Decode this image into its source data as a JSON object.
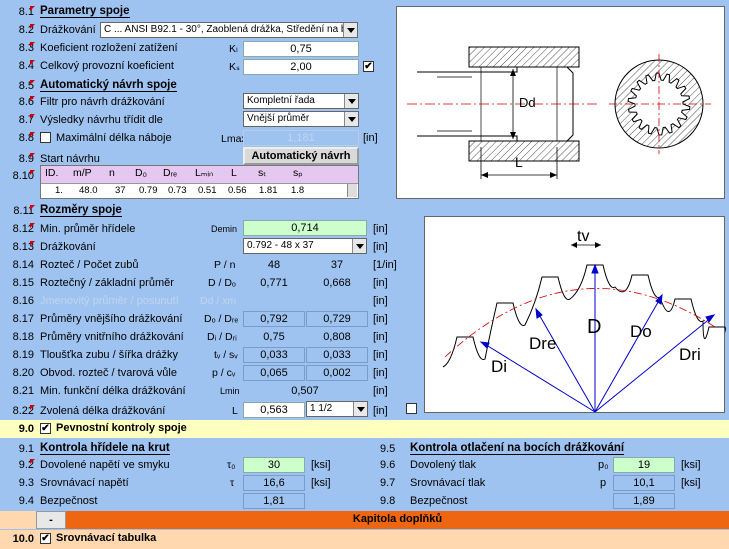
{
  "colors": {
    "background": "#9fc3f0",
    "input_green": "#ccffcc",
    "section_yellow": "#ffffc0",
    "chapter_orange": "#ee6611",
    "chapter_bg": "#ffd8b0",
    "marker_red": "#d00000"
  },
  "s81": {
    "num": "8.1",
    "title": "Parametry spoje"
  },
  "s82": {
    "num": "8.2",
    "label": "Drážkování",
    "value": "C ... ANSI B92.1 - 30°, Zaoblená drážka, Středění na bok"
  },
  "s83": {
    "num": "8.3",
    "label": "Koeficient rozložení zatížení",
    "sym": "Kₗ",
    "value": "0,75"
  },
  "s84": {
    "num": "8.4",
    "label": "Celkový provozní koeficient",
    "sym": "Kₛ",
    "value": "2,00",
    "checked": "✔"
  },
  "s85": {
    "num": "8.5",
    "title": "Automatický návrh spoje"
  },
  "s86": {
    "num": "8.6",
    "label": "Filtr pro návrh drážkování",
    "value": "Kompletní řada"
  },
  "s87": {
    "num": "8.7",
    "label": "Výsledky návrhu třídit dle",
    "value": "Vnější průměr"
  },
  "s88": {
    "num": "8.8",
    "label": "Maximální délka náboje",
    "sym": "Lmax",
    "value": "1,181",
    "unit": "[in]"
  },
  "s89": {
    "num": "8.9",
    "label": "Start návrhu",
    "button": "Automatický návrh"
  },
  "s810": {
    "num": "8.10",
    "headers": [
      "ID.",
      "m/P",
      "n",
      "D₀",
      "Dᵣₑ",
      "Lₘᵢₙ",
      "L",
      "sₜ",
      "sₚ"
    ],
    "row": [
      "1.",
      "48.0",
      "37",
      "0.79",
      "0.73",
      "0.51",
      "0.56",
      "1.81",
      "1.8"
    ]
  },
  "s811": {
    "num": "8.11",
    "title": "Rozměry spoje"
  },
  "s812": {
    "num": "8.12",
    "label": "Min. průměr hřídele",
    "sym": "Demin",
    "value": "0,714",
    "unit": "[in]"
  },
  "s813": {
    "num": "8.13",
    "label": "Drážkování",
    "value": "0.792 - 48 x 37",
    "unit": "[in]"
  },
  "s814": {
    "num": "8.14",
    "label": "Rozteč / Počet zubů",
    "sym": "P / n",
    "v1": "48",
    "v2": "37",
    "unit": "[1/in]"
  },
  "s815": {
    "num": "8.15",
    "label": "Roztečný / základní průměr",
    "sym": "D / Dₒ",
    "v1": "0,771",
    "v2": "0,668",
    "unit": "[in]"
  },
  "s816": {
    "num": "8.16",
    "label": "Jmenovitý průměr / posunutí",
    "sym": "Dd / xm",
    "unit": "[in]"
  },
  "s817": {
    "num": "8.17",
    "label": "Průměry vnějšího drážkování",
    "sym": "Dₒ / Dᵣₑ",
    "v1": "0,792",
    "v2": "0,729",
    "unit": "[in]"
  },
  "s818": {
    "num": "8.18",
    "label": "Průměry vnitřního drážkování",
    "sym": "Dᵢ / Dᵣᵢ",
    "v1": "0,75",
    "v2": "0,808",
    "unit": "[in]"
  },
  "s819": {
    "num": "8.19",
    "label": "Tloušťka zubu / šířka drážky",
    "sym": "tᵥ / sᵥ",
    "v1": "0,033",
    "v2": "0,033",
    "unit": "[in]"
  },
  "s820": {
    "num": "8.20",
    "label": "Obvod. rozteč / tvarová vůle",
    "sym": "p / cᵥ",
    "v1": "0,065",
    "v2": "0,002",
    "unit": "[in]"
  },
  "s821": {
    "num": "8.21",
    "label": "Min. funkční délka drážkování",
    "sym": "Lmin",
    "value": "0,507",
    "unit": "[in]"
  },
  "s822": {
    "num": "8.22",
    "label": "Zvolená délka drážkování",
    "sym": "L",
    "value": "0,563",
    "combo": "1 1/2",
    "unit": "[in]"
  },
  "s90": {
    "num": "9.0",
    "title": "Pevnostní kontroly spoje",
    "checked": "✔"
  },
  "s91": {
    "num": "9.1",
    "title": "Kontrola hřídele na krut"
  },
  "s92": {
    "num": "9.2",
    "label": "Dovolené napětí ve smyku",
    "sym": "τ₀",
    "value": "30",
    "unit": "[ksi]"
  },
  "s93": {
    "num": "9.3",
    "label": "Srovnávací napětí",
    "sym": "τ",
    "value": "16,6",
    "unit": "[ksi]"
  },
  "s94": {
    "num": "9.4",
    "label": "Bezpečnost",
    "value": "1,81"
  },
  "s95": {
    "num": "9.5",
    "title": "Kontrola otlačení na bocích drážkování"
  },
  "s96": {
    "num": "9.6",
    "label": "Dovolený tlak",
    "sym": "p₀",
    "value": "19",
    "unit": "[ksi]"
  },
  "s97": {
    "num": "9.7",
    "label": "Srovnávací tlak",
    "sym": "p",
    "value": "10,1",
    "unit": "[ksi]"
  },
  "s98": {
    "num": "9.8",
    "label": "Bezpečnost",
    "value": "1,89"
  },
  "chapter": {
    "minus": "-",
    "title": "Kapitola doplňků"
  },
  "s100": {
    "num": "10.0",
    "title": "Srovnávací tabulka",
    "checked": "✔"
  },
  "fig1": {
    "dim_d": "Dd",
    "dim_l": "L"
  },
  "fig2": {
    "tv": "tv",
    "D": "D",
    "Do": "Do",
    "Dre": "Dre",
    "Dri": "Dri",
    "Di": "Di"
  }
}
